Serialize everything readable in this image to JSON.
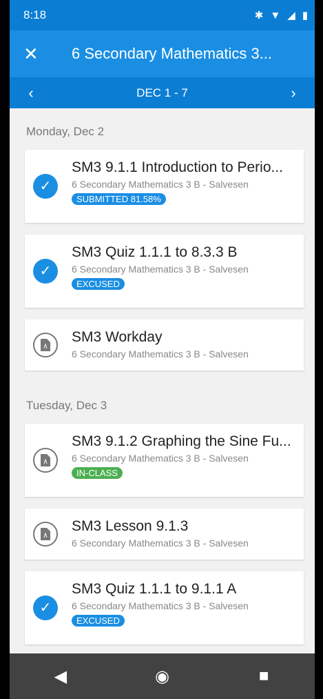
{
  "status": {
    "time": "8:18"
  },
  "app": {
    "title": "6 Secondary Mathematics 3..."
  },
  "week": {
    "label": "DEC 1 - 7"
  },
  "days": [
    {
      "label": "Monday, Dec 2",
      "items": [
        {
          "title": "SM3 9.1.1 Introduction to Perio...",
          "course": "6 Secondary Mathematics 3 B - Salvesen",
          "badge": "SUBMITTED  81.58%"
        },
        {
          "title": "SM3 Quiz 1.1.1 to 8.3.3 B",
          "course": "6 Secondary Mathematics 3 B - Salvesen",
          "badge": "EXCUSED"
        },
        {
          "title": "SM3 Workday",
          "course": "6 Secondary Mathematics 3 B - Salvesen"
        }
      ]
    },
    {
      "label": "Tuesday, Dec 3",
      "items": [
        {
          "title": "SM3 9.1.2 Graphing the Sine Fu...",
          "course": "6 Secondary Mathematics 3 B - Salvesen",
          "badge": "IN-CLASS"
        },
        {
          "title": "SM3 Lesson 9.1.3",
          "course": "6 Secondary Mathematics 3 B - Salvesen"
        },
        {
          "title": "SM3 Quiz 1.1.1 to 9.1.1 A",
          "course": "6 Secondary Mathematics 3 B - Salvesen",
          "badge": "EXCUSED"
        }
      ]
    }
  ]
}
